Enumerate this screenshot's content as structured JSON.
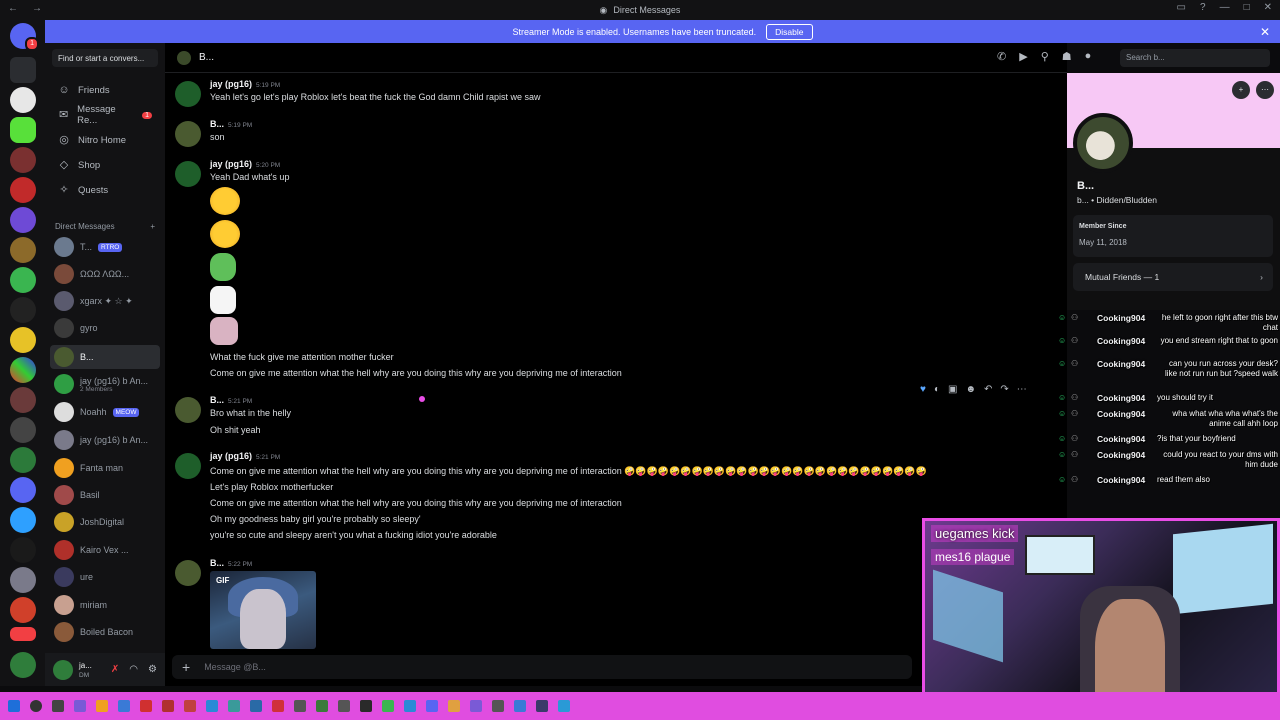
{
  "window": {
    "title": "Direct Messages"
  },
  "banner": {
    "text": "Streamer Mode is enabled. Usernames have been truncated.",
    "button": "Disable"
  },
  "sidebar": {
    "search_placeholder": "Find or start a convers...",
    "nav": [
      {
        "label": "Friends",
        "icon": "friends-icon"
      },
      {
        "label": "Message Re...",
        "icon": "message-requests-icon",
        "count": "1"
      },
      {
        "label": "Nitro Home",
        "icon": "nitro-icon"
      },
      {
        "label": "Shop",
        "icon": "shop-icon"
      },
      {
        "label": "Quests",
        "icon": "quests-icon"
      }
    ],
    "dm_header": "Direct Messages",
    "dm_add": "+",
    "dms": [
      {
        "name": "T...",
        "tag": "RTRO",
        "color": "#6b7a8f"
      },
      {
        "name": "ΩΩΩ ΛΩΩ...",
        "color": "#7a4a3a"
      },
      {
        "name": "xgarx ✦ ☆ ✦",
        "color": "#5a5a6e"
      },
      {
        "name": "gyro",
        "color": "#3a3a3a"
      },
      {
        "name": "B...",
        "color": "#4a5a30",
        "active": true
      },
      {
        "name": "jay (pg16) b An...",
        "sub": "2 Members",
        "color": "#2f9e44"
      },
      {
        "name": "Noahh",
        "tag": "MEOW",
        "color": "#dddddd"
      },
      {
        "name": "jay (pg16) b An...",
        "color": "#7a7a8a"
      },
      {
        "name": "Fanta man",
        "color": "#f0a020"
      },
      {
        "name": "Basil",
        "color": "#a04a4a"
      },
      {
        "name": "JoshDigital",
        "color": "#c9a227"
      },
      {
        "name": "Kairo Vex ...",
        "color": "#b0302a"
      },
      {
        "name": "ure",
        "color": "#3a3a5e"
      },
      {
        "name": "miriam",
        "color": "#c8a090"
      },
      {
        "name": "Boiled Bacon",
        "color": "#8a5a3a"
      }
    ]
  },
  "user": {
    "name": "ja...",
    "status": "DM"
  },
  "chat": {
    "channel": "B...",
    "search_placeholder": "Search b...",
    "composer_placeholder": "Message @B...",
    "messages": [
      {
        "author": "jay (pg16)",
        "time": "5:19 PM",
        "color": "#1e5e2a",
        "lines": [
          "Yeah let's go let's play Roblox let's beat the fuck the God damn  Child rapist we saw"
        ]
      },
      {
        "author": "B...",
        "time": "5:19 PM",
        "color": "#4a5a30",
        "lines": [
          "son"
        ]
      },
      {
        "author": "jay (pg16)",
        "time": "5:20 PM",
        "color": "#1e5e2a",
        "lines": [
          "Yeah Dad what's up",
          "What the fuck give me attention mother fucker",
          "Come on give me attention what the hell why are you doing this why are you depriving me of interaction"
        ]
      },
      {
        "author": "B...",
        "time": "5:21 PM",
        "color": "#4a5a30",
        "lines": [
          "Bro what in the helly",
          "Oh shit yeah"
        ]
      },
      {
        "author": "jay (pg16)",
        "time": "5:21 PM",
        "color": "#1e5e2a",
        "lines": [
          "Come on give me attention what the hell why are you doing this why are you depriving me of interaction 🤪🤪🤪🤪🤪🤪🤪🤪🤪🤪🤪🤪🤪🤪🤪🤪🤪🤪🤪🤪🤪🤪🤪🤪🤪🤪🤪",
          "Let's play Roblox motherfucker",
          "Come on give me attention what the hell why are you doing this why are you depriving me of interaction",
          "Oh my goodness baby girl you're probably so sleepy'",
          "you're so cute and sleepy aren't you what a fucking idiot you're adorable"
        ]
      },
      {
        "author": "B...",
        "time": "5:22 PM",
        "color": "#4a5a30",
        "gif_label": "GIF"
      }
    ]
  },
  "profile": {
    "name": "B...",
    "tag": "b... • Didden/Bludden",
    "member_since_label": "Member Since",
    "member_since": "May 11, 2018",
    "mutual": "Mutual Friends — 1"
  },
  "stream_chat": [
    {
      "user": "Cooking904",
      "text": "he left to goon right after this btw chat"
    },
    {
      "user": "Cooking904",
      "text": "you end stream right that to goon"
    },
    {
      "user": "Cooking904",
      "text": "can you run across your desk? like not run run but ?speed walk"
    },
    {
      "user": "Cooking904",
      "text": "you should try it"
    },
    {
      "user": "Cooking904",
      "text": "wha what wha wha what's the anime call ahh loop"
    },
    {
      "user": "Cooking904",
      "text": "?is that your boyfriend"
    },
    {
      "user": "Cooking904",
      "text": "could you react to your dms with him dude"
    },
    {
      "user": "Cooking904",
      "text": "read them also"
    }
  ],
  "webcam": {
    "overlay1": "uegames kick",
    "overlay2": "mes16 plague"
  },
  "colors": {
    "accent": "#5865f2",
    "taskbar": "#e04de0",
    "webcam_border": "#e94de6"
  }
}
